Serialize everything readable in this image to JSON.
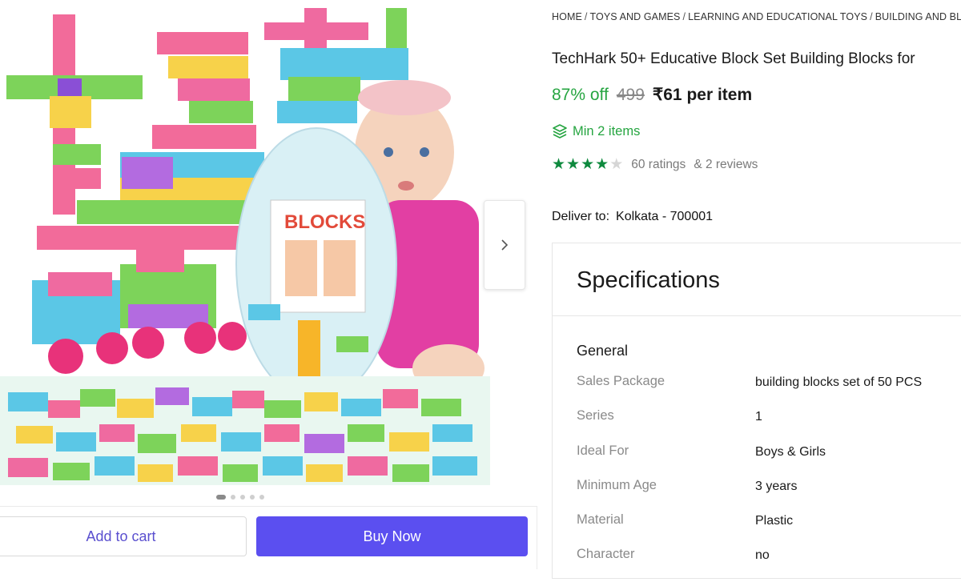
{
  "breadcrumb": [
    "HOME",
    "TOYS AND GAMES",
    "LEARNING AND EDUCATIONAL TOYS",
    "BUILDING AND BL"
  ],
  "product": {
    "title": "TechHark 50+ Educative Block Set Building Blocks for",
    "discount": "87% off",
    "mrp": "499",
    "price": "₹61 per item",
    "min_items": "Min 2 items",
    "rating_value": 4,
    "rating_max": 5,
    "ratings_text": "60 ratings",
    "reviews_text": "& 2 reviews",
    "deliver_label": "Deliver to:",
    "deliver_location": "Kolkata - 700001"
  },
  "gallery": {
    "image_count": 5,
    "active_index": 0,
    "image_bag_label": "BLOCKS"
  },
  "actions": {
    "add_to_cart": "Add to cart",
    "buy_now": "Buy Now"
  },
  "specifications": {
    "heading": "Specifications",
    "group": "General",
    "rows": [
      {
        "key": "Sales Package",
        "value": "building blocks set of 50 PCS"
      },
      {
        "key": "Series",
        "value": "1"
      },
      {
        "key": "Ideal For",
        "value": "Boys & Girls"
      },
      {
        "key": "Minimum Age",
        "value": "3 years"
      },
      {
        "key": "Material",
        "value": "Plastic"
      },
      {
        "key": "Character",
        "value": "no"
      }
    ]
  },
  "colors": {
    "accent": "#5b4ff0",
    "green": "#26a541",
    "star": "#0e8a3e"
  }
}
